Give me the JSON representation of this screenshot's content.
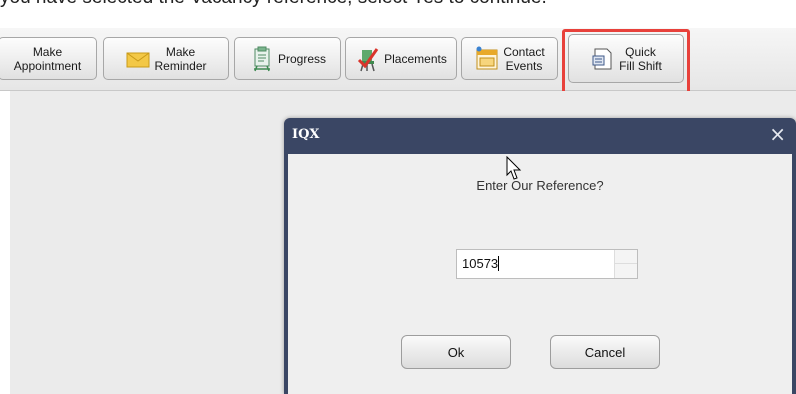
{
  "top_text": "you have selected the Vacancy reference, select Yes to continue.",
  "toolbar": {
    "buttons": [
      {
        "line1": "Make",
        "line2": "Appointment",
        "icon": "appointment-icon"
      },
      {
        "line1": "Make",
        "line2": "Reminder",
        "icon": "envelope-icon"
      },
      {
        "label": "Progress",
        "icon": "progress-clipboard-icon"
      },
      {
        "label": "Placements",
        "icon": "placements-chair-icon"
      },
      {
        "line1": "Contact",
        "line2": "Events",
        "icon": "calendar-icon"
      },
      {
        "line1": "Quick",
        "line2": "Fill Shift",
        "icon": "quick-fill-shift-icon"
      }
    ],
    "highlight_color": "#e8413b"
  },
  "dialog": {
    "title": "IQX",
    "close_glyph": "×",
    "prompt": "Enter Our Reference?",
    "input_value": "10573",
    "ok_label": "Ok",
    "cancel_label": "Cancel",
    "title_bar_color": "#3a4664"
  }
}
